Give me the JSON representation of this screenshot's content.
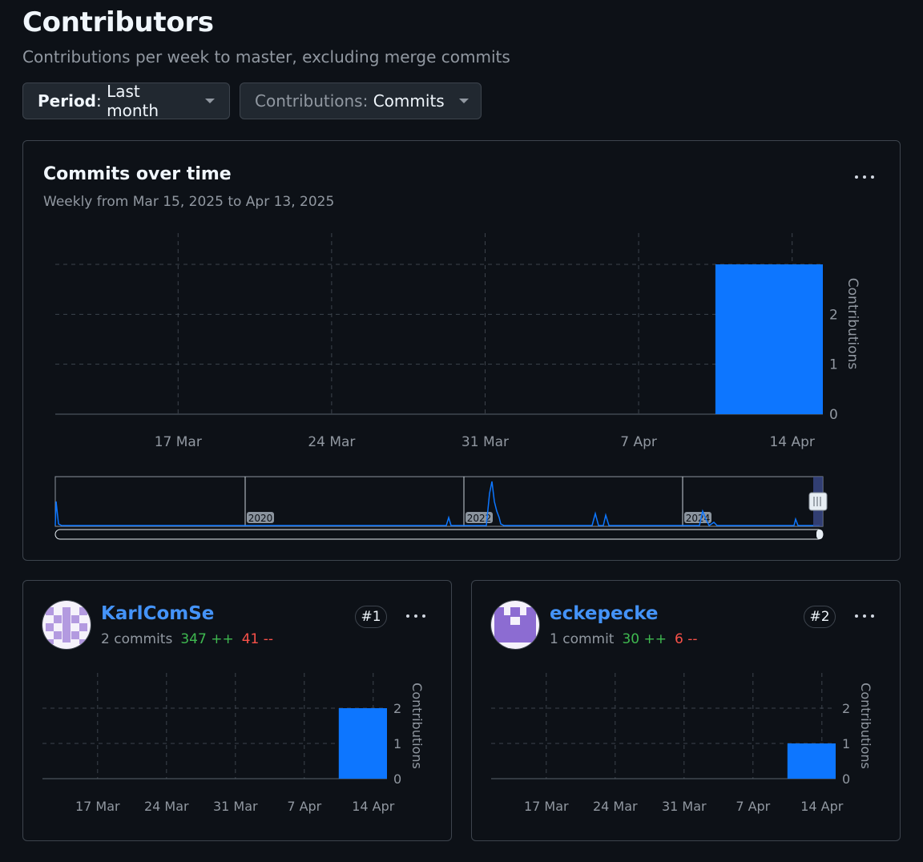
{
  "header": {
    "title": "Contributors",
    "subtitle": "Contributions per week to master, excluding merge commits"
  },
  "filters": {
    "period_key": "Period",
    "period_value": "Last month",
    "contrib_key": "Contributions",
    "contrib_value": "Commits"
  },
  "overview": {
    "title": "Commits over time",
    "subtitle": "Weekly from Mar 15, 2025 to Apr 13, 2025",
    "navigator_years": [
      "2020",
      "2022",
      "2024"
    ]
  },
  "contributors": [
    {
      "name": "KarlComSe",
      "commits": "2 commits",
      "additions": "347 ++",
      "deletions": "41 --",
      "rank": "#1"
    },
    {
      "name": "eckepecke",
      "commits": "1 commit",
      "additions": "30 ++",
      "deletions": "6 --",
      "rank": "#2"
    }
  ],
  "colors": {
    "bar": "#0d76ff",
    "additions": "#3fb950",
    "deletions": "#f85149",
    "link": "#4493f8"
  },
  "chart_data": [
    {
      "type": "bar",
      "categories": [
        "17 Mar",
        "24 Mar",
        "31 Mar",
        "7 Apr",
        "14 Apr"
      ],
      "values": [
        0,
        0,
        0,
        0,
        3
      ],
      "ylabel": "Contributions",
      "yticks": [
        0,
        1,
        2
      ],
      "ylim": [
        0,
        3
      ]
    },
    {
      "type": "bar",
      "categories": [
        "17 Mar",
        "24 Mar",
        "31 Mar",
        "7 Apr",
        "14 Apr"
      ],
      "values": [
        0,
        0,
        0,
        0,
        2
      ],
      "ylabel": "Contributions",
      "yticks": [
        0,
        1,
        2
      ],
      "ylim": [
        0,
        2
      ]
    },
    {
      "type": "bar",
      "categories": [
        "17 Mar",
        "24 Mar",
        "31 Mar",
        "7 Apr",
        "14 Apr"
      ],
      "values": [
        0,
        0,
        0,
        0,
        1
      ],
      "ylabel": "Contributions",
      "yticks": [
        0,
        1,
        2
      ],
      "ylim": [
        0,
        2
      ]
    }
  ]
}
